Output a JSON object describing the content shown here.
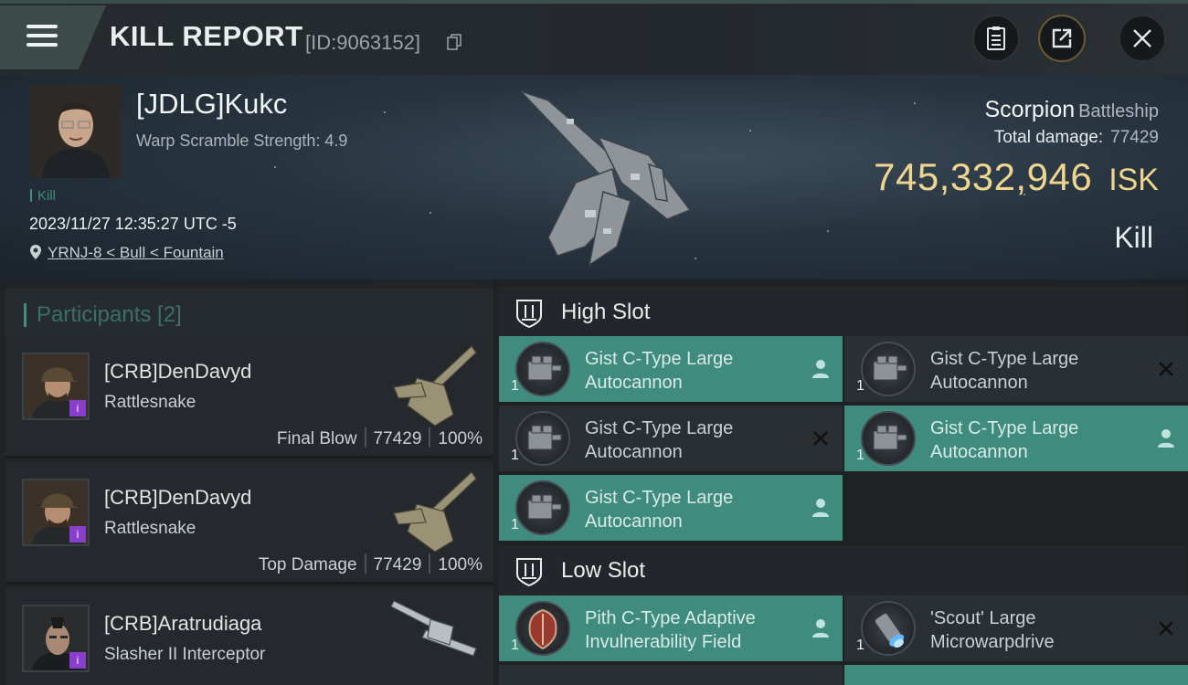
{
  "header": {
    "title": "KILL REPORT",
    "report_id": "[ID:9063152]"
  },
  "victim": {
    "name": "[JDLG]Kukc",
    "scramble": "Warp Scramble Strength: 4.9",
    "tag": "Kill",
    "time": "2023/11/27 12:35:27 UTC -5",
    "location": "YRNJ-8 < Bull < Fountain",
    "ship_name": "Scorpion",
    "ship_class": "Battleship",
    "total_damage_label": "Total damage:",
    "total_damage": "77429",
    "isk_value": "745,332,946",
    "isk_unit": "ISK",
    "result": "Kill"
  },
  "participants": {
    "title": "Participants [2]",
    "rows": [
      {
        "name": "[CRB]DenDavyd",
        "ship": "Rattlesnake",
        "role": "Final Blow",
        "damage": "77429",
        "percent": "100%",
        "badge": "i"
      },
      {
        "name": "[CRB]DenDavyd",
        "ship": "Rattlesnake",
        "role": "Top Damage",
        "damage": "77429",
        "percent": "100%",
        "badge": "i"
      },
      {
        "name": "[CRB]Aratrudiaga",
        "ship": "Slasher II Interceptor",
        "badge": "i"
      }
    ]
  },
  "fittings": {
    "high_slot_title": "High Slot",
    "low_slot_title": "Low Slot",
    "high": [
      {
        "line1": "Gist C-Type Large",
        "line2": "Autocannon",
        "qty": "1",
        "state": "dropped"
      },
      {
        "line1": "Gist C-Type Large",
        "line2": "Autocannon",
        "qty": "1",
        "state": "destroyed"
      },
      {
        "line1": "Gist C-Type Large",
        "line2": "Autocannon",
        "qty": "1",
        "state": "destroyed"
      },
      {
        "line1": "Gist C-Type Large",
        "line2": "Autocannon",
        "qty": "1",
        "state": "dropped"
      },
      {
        "line1": "Gist C-Type Large",
        "line2": "Autocannon",
        "qty": "1",
        "state": "dropped"
      }
    ],
    "low": [
      {
        "line1": "Pith C-Type Adaptive",
        "line2": "Invulnerability Field",
        "qty": "1",
        "state": "dropped"
      },
      {
        "line1": "'Scout' Large",
        "line2": "Microwarpdrive",
        "qty": "1",
        "state": "destroyed"
      }
    ]
  },
  "colors": {
    "accent_teal": "#3f8b7d",
    "isk_gold": "#efd58d",
    "badge_purple": "#8a3fcc"
  }
}
